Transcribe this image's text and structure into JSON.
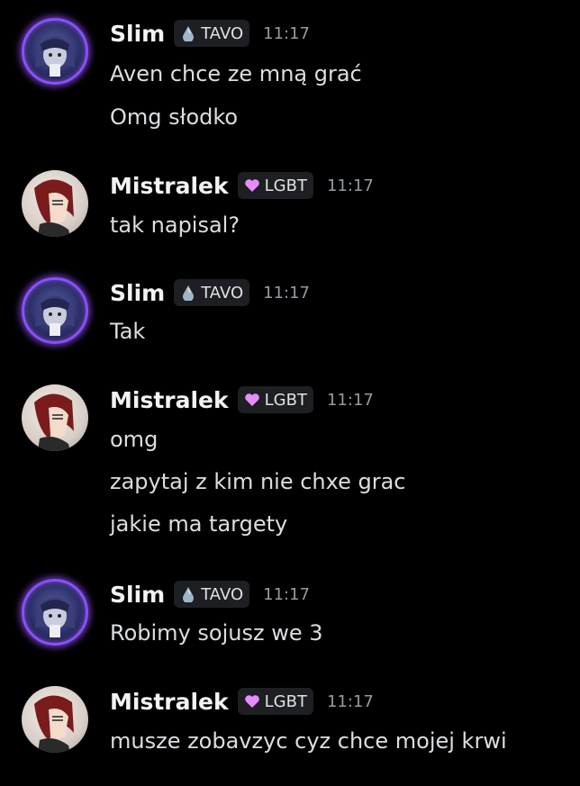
{
  "messages": [
    {
      "author": "Slim",
      "tag": "TAVO",
      "tag_icon": "droplet-icon",
      "time": "11:17",
      "lines": [
        "Aven chce ze mną grać",
        "Omg słodko"
      ]
    },
    {
      "author": "Mistralek",
      "tag": "LGBT",
      "tag_icon": "heart-icon",
      "time": "11:17",
      "lines": [
        "tak napisal?"
      ]
    },
    {
      "author": "Slim",
      "tag": "TAVO",
      "tag_icon": "droplet-icon",
      "time": "11:17",
      "lines": [
        "Tak"
      ]
    },
    {
      "author": "Mistralek",
      "tag": "LGBT",
      "tag_icon": "heart-icon",
      "time": "11:17",
      "lines": [
        "omg",
        "zapytaj z kim nie chxe grac",
        "jakie ma targety"
      ]
    },
    {
      "author": "Slim",
      "tag": "TAVO",
      "tag_icon": "droplet-icon",
      "time": "11:17",
      "lines": [
        "Robimy sojusz we 3"
      ]
    },
    {
      "author": "Mistralek",
      "tag": "LGBT",
      "tag_icon": "heart-icon",
      "time": "11:17",
      "lines": [
        "musze zobavzyc cyz chce mojej krwi"
      ]
    }
  ],
  "colors": {
    "background": "#000000",
    "username": "#f2f3f5",
    "message_text": "#dbdee1",
    "timestamp": "#949ba4",
    "tag_background": "#1e1f22",
    "slim_avatar_glow": "#8a4fff",
    "heart": "#e68cff",
    "droplet": "#9fb6c8"
  }
}
